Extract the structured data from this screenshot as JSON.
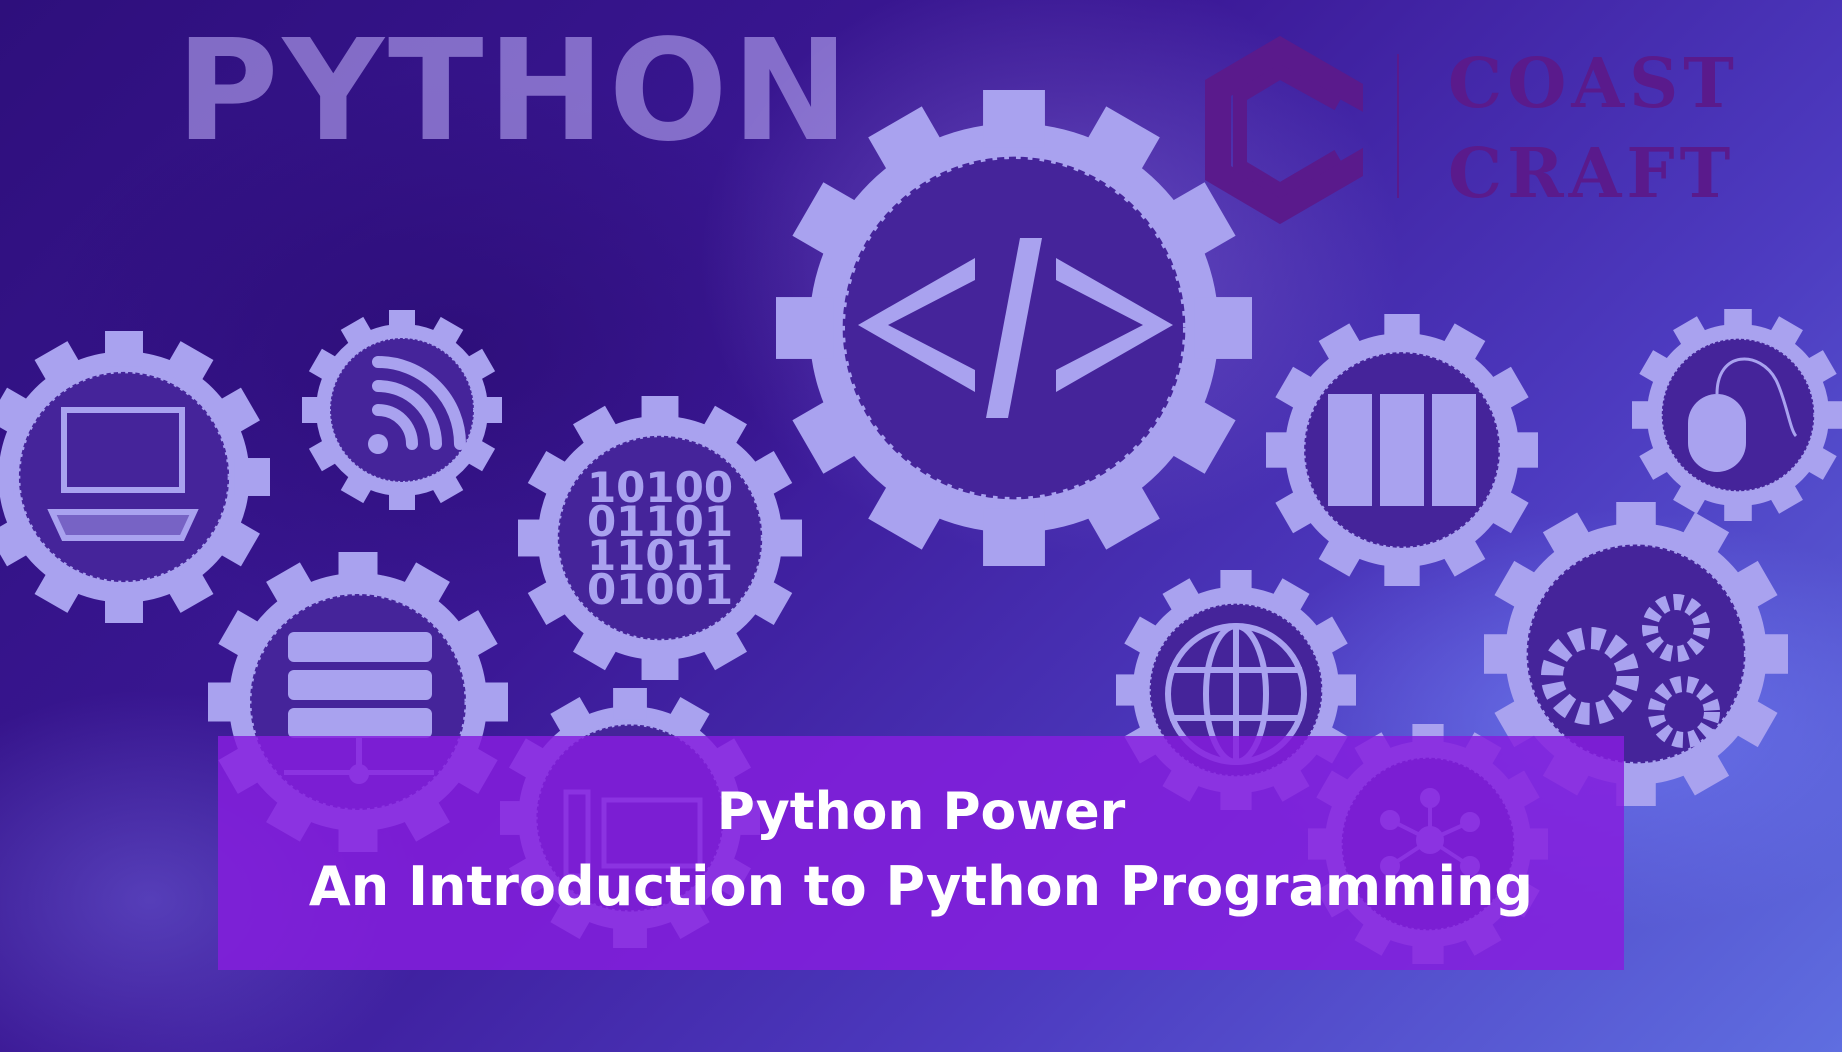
{
  "image": {
    "title_word": "PYTHON",
    "logo": {
      "line1": "COAST",
      "line2": "CRAFT",
      "brand_color": "#5a1a8c"
    },
    "banner": {
      "line1": "Python Power",
      "line2": "An Introduction to Python Programming",
      "color": "#861ede"
    },
    "binary_digits": [
      "10100",
      "01101",
      "11011",
      "01001"
    ],
    "icons": [
      "laptop-icon",
      "wifi-icon",
      "binary-icon",
      "code-icon",
      "server-racks-icon",
      "mouse-icon",
      "database-network-icon",
      "computer-icon",
      "globe-icon",
      "network-nodes-icon",
      "gears-icon"
    ]
  }
}
